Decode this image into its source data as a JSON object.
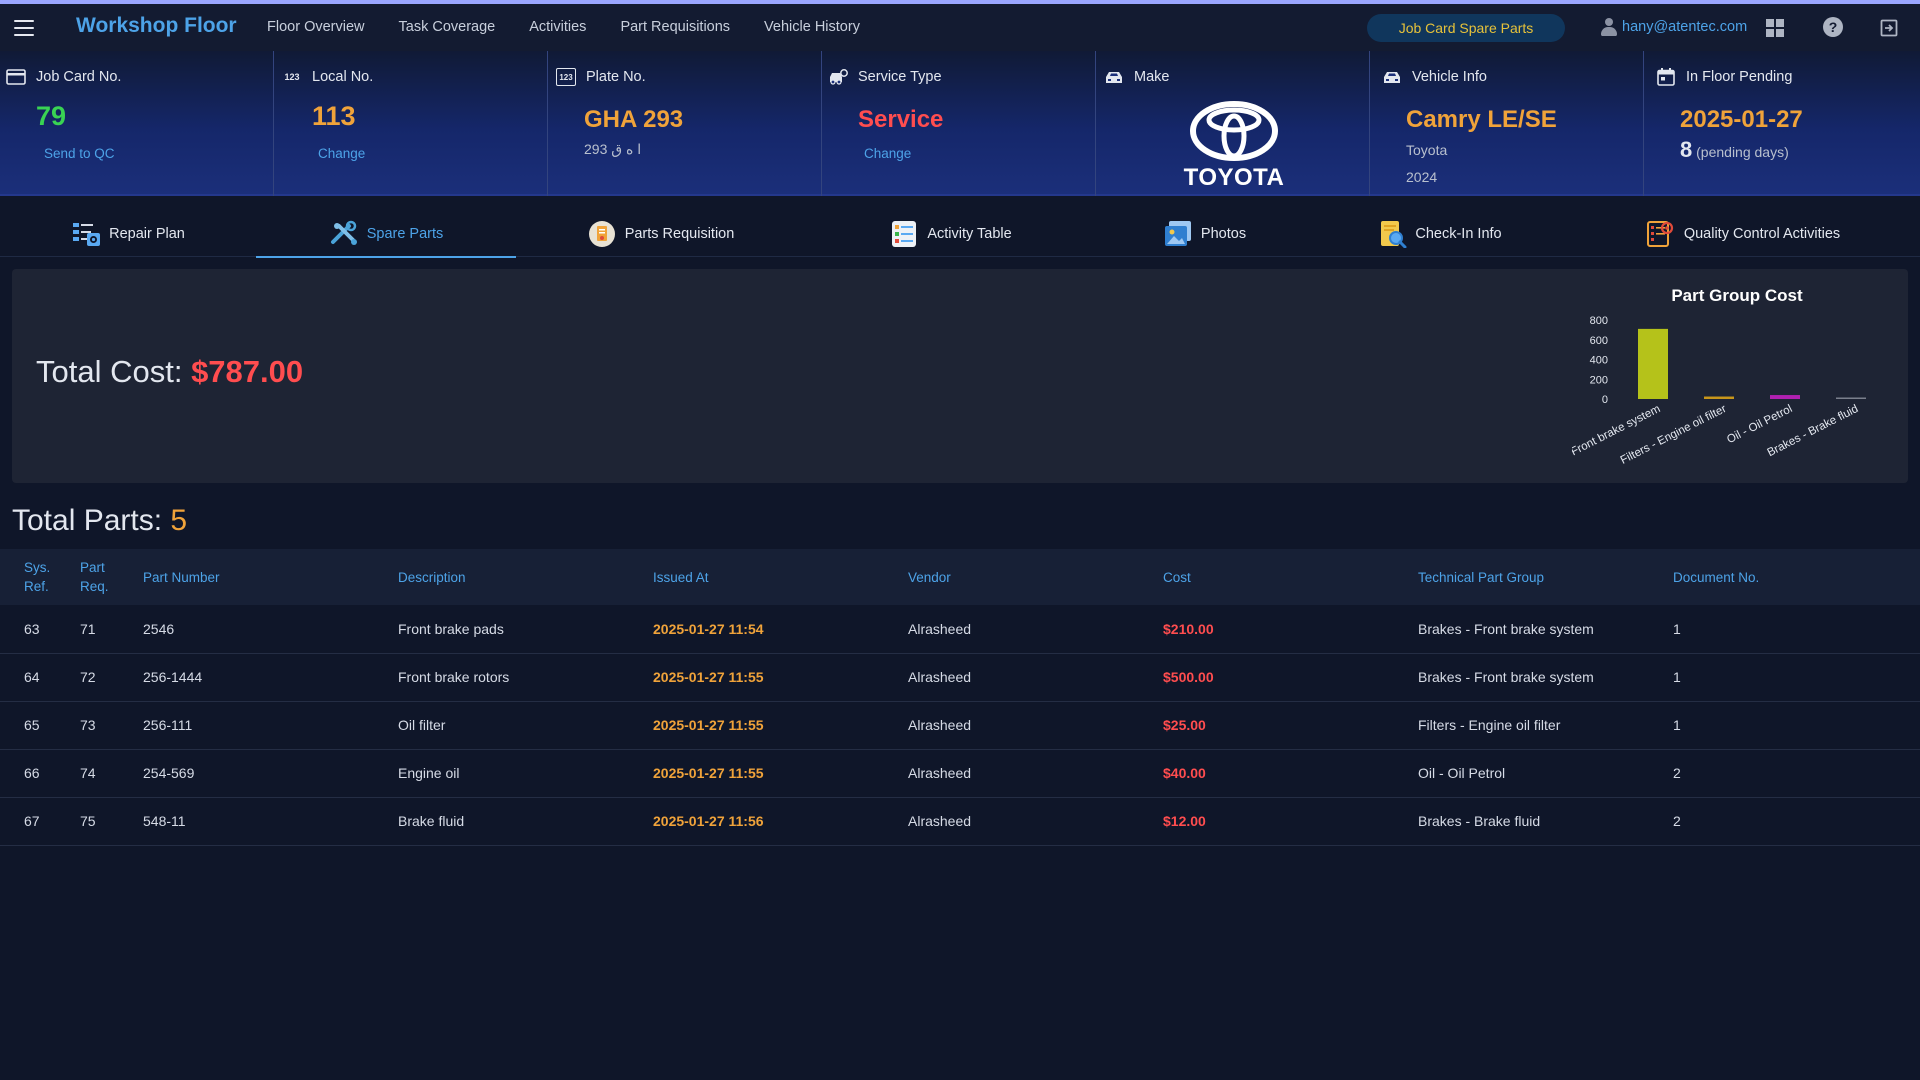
{
  "navbar": {
    "brand": "Workshop Floor",
    "links": [
      "Floor Overview",
      "Task Coverage",
      "Activities",
      "Part Requisitions",
      "Vehicle History"
    ],
    "page_pill": "Job Card Spare Parts",
    "user_email": "hany@atentec.com",
    "icons": [
      "menu-icon",
      "user-icon",
      "grid-icon",
      "help-icon",
      "logout-icon"
    ]
  },
  "cards": {
    "job_card": {
      "label": "Job Card No.",
      "value": "79",
      "action": "Send to QC"
    },
    "local_no": {
      "label": "Local No.",
      "value": "113",
      "action": "Change",
      "icon_text": "123"
    },
    "plate": {
      "label": "Plate No.",
      "value": "GHA 293",
      "arabic": "293 ا ه ق",
      "icon_text": "123"
    },
    "service": {
      "label": "Service Type",
      "value": "Service",
      "action": "Change"
    },
    "make": {
      "label": "Make",
      "brand_text": "TOYOTA"
    },
    "vehicle": {
      "label": "Vehicle Info",
      "model": "Camry LE/SE",
      "make": "Toyota",
      "year": "2024"
    },
    "floor": {
      "label": "In Floor Pending",
      "date": "2025-01-27",
      "days": "8",
      "days_label": "(pending days)"
    }
  },
  "tabs": [
    {
      "label": "Repair Plan",
      "active": false
    },
    {
      "label": "Spare Parts",
      "active": true
    },
    {
      "label": "Parts Requisition",
      "active": false
    },
    {
      "label": "Activity Table",
      "active": false
    },
    {
      "label": "Photos",
      "active": false
    },
    {
      "label": "Check-In Info",
      "active": false
    },
    {
      "label": "Quality Control Activities",
      "active": false
    }
  ],
  "cost": {
    "label": "Total Cost: ",
    "value": "$787.00"
  },
  "chart_data": {
    "type": "bar",
    "title": "Part Group Cost",
    "categories": [
      "Brakes - Front brake system",
      "Filters - Engine oil filter",
      "Oil - Oil Petrol",
      "Brakes - Brake fluid"
    ],
    "values": [
      710,
      25,
      40,
      12
    ],
    "colors": [
      "#b5c21a",
      "#c8961a",
      "#b020b0",
      "#7a7f8c"
    ],
    "yticks": [
      "800",
      "600",
      "400",
      "200",
      "0"
    ],
    "ylim": [
      0,
      800
    ],
    "xlabel": "",
    "ylabel": ""
  },
  "parts": {
    "label": "Total Parts: ",
    "count": "5",
    "columns": [
      [
        "Sys.",
        "Ref."
      ],
      [
        "Part",
        "Req."
      ],
      [
        "Part Number"
      ],
      [
        "Description"
      ],
      [
        "Issued At"
      ],
      [
        "Vendor"
      ],
      [
        "Cost"
      ],
      [
        "Technical Part Group"
      ],
      [
        "Document No."
      ]
    ],
    "rows": [
      [
        "63",
        "71",
        "2546",
        "Front brake pads",
        "2025-01-27 11:54",
        "Alrasheed",
        "$210.00",
        "Brakes - Front brake system",
        "1"
      ],
      [
        "64",
        "72",
        "256-1444",
        "Front brake rotors",
        "2025-01-27 11:55",
        "Alrasheed",
        "$500.00",
        "Brakes - Front brake system",
        "1"
      ],
      [
        "65",
        "73",
        "256-111",
        "Oil filter",
        "2025-01-27 11:55",
        "Alrasheed",
        "$25.00",
        "Filters - Engine oil filter",
        "1"
      ],
      [
        "66",
        "74",
        "254-569",
        "Engine oil",
        "2025-01-27 11:55",
        "Alrasheed",
        "$40.00",
        "Oil - Oil Petrol",
        "2"
      ],
      [
        "67",
        "75",
        "548-11",
        "Brake fluid",
        "2025-01-27 11:56",
        "Alrasheed",
        "$12.00",
        "Brakes - Brake fluid",
        "2"
      ]
    ]
  }
}
